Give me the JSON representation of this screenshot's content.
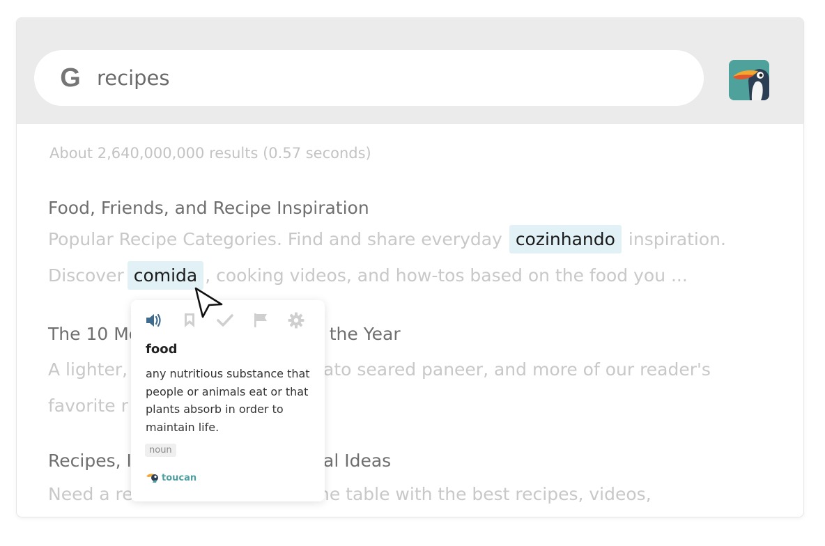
{
  "search": {
    "query": "recipes",
    "engine_icon": "google-g-icon"
  },
  "extension": {
    "avatar_icon": "toucan-avatar-icon"
  },
  "results_stats": "About 2,640,000,000 results (0.57 seconds)",
  "results": [
    {
      "title": "Food, Friends, and Recipe Inspiration",
      "line1_before": "Popular Recipe Categories. Find and share everyday",
      "line1_highlight": "cozinhando",
      "line1_after": "inspiration.",
      "line2_before": "Discover",
      "line2_highlight": "comida",
      "line2_after": ", cooking videos, and how-tos based on the food you ..."
    },
    {
      "title_left": "The 10 Mo",
      "title_right": "f the Year",
      "line1_left": "A lighter,",
      "line1_right": "ato seared paneer, and more of our reader's",
      "line2_left": "favorite r"
    },
    {
      "title_left": "Recipes, I",
      "title_right": "al Ideas",
      "line1_left": "Need a re",
      "line1_right": "he table with the best recipes, videos,"
    }
  ],
  "popup": {
    "toolbar": [
      "speaker-icon",
      "bookmark-icon",
      "check-icon",
      "flag-icon",
      "gear-icon"
    ],
    "word": "food",
    "definition": "any nutritious substance that people or animals eat or that plants absorb in order to maintain life.",
    "part_of_speech": "noun",
    "brand": "toucan"
  },
  "colors": {
    "highlight": "#e2f1f6",
    "brand": "#4f9fa1",
    "speaker": "#3f6b8f",
    "topbar": "#ebebeb"
  }
}
